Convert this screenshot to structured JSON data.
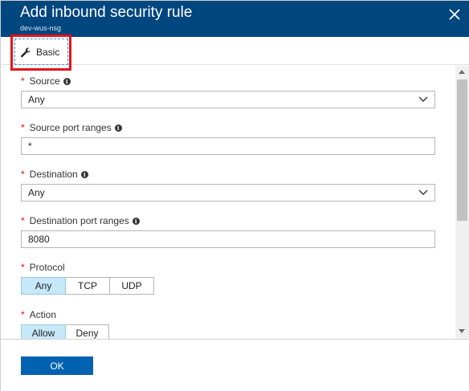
{
  "header": {
    "title": "Add inbound security rule",
    "subtitle": "dev-wus-nsg",
    "close_icon": "close-icon"
  },
  "toolbar": {
    "tab_label": "Basic",
    "tab_icon": "wrench-icon"
  },
  "form": {
    "required_mark": "*",
    "info_mark": "i",
    "source": {
      "label": "Source",
      "value": "Any"
    },
    "source_port": {
      "label": "Source port ranges",
      "value": "*"
    },
    "destination": {
      "label": "Destination",
      "value": "Any"
    },
    "destination_port": {
      "label": "Destination port ranges",
      "value": "8080"
    },
    "protocol": {
      "label": "Protocol",
      "options": [
        "Any",
        "TCP",
        "UDP"
      ],
      "selected": "Any"
    },
    "action": {
      "label": "Action",
      "options": [
        "Allow",
        "Deny"
      ],
      "selected": "Allow"
    }
  },
  "footer": {
    "ok_label": "OK"
  },
  "colors": {
    "header_bg": "#00467f",
    "primary_button": "#0062b0",
    "selected_segment": "#c6e8f9",
    "highlight_border": "#e3151a",
    "required": "#e00000"
  }
}
